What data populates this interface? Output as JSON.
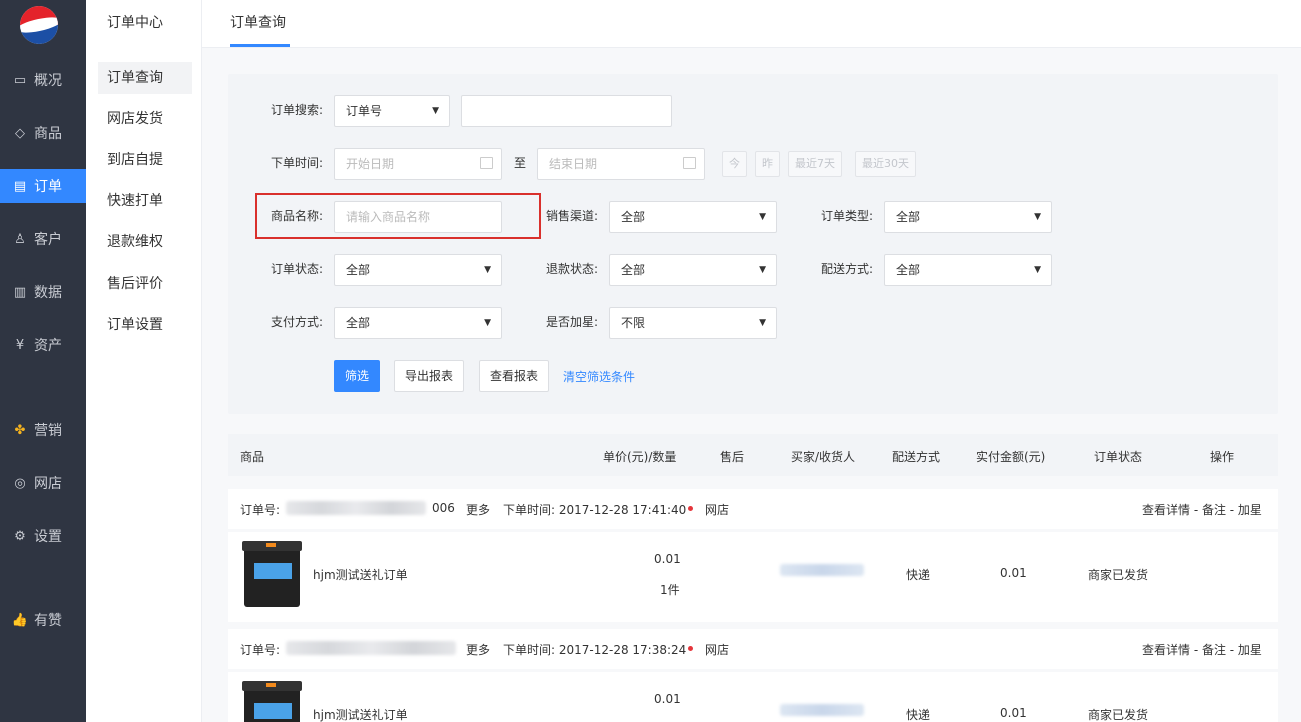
{
  "sidebar": {
    "items": [
      {
        "label": "概况",
        "icon": "monitor-icon"
      },
      {
        "label": "商品",
        "icon": "tag-icon"
      },
      {
        "label": "订单",
        "icon": "document-icon",
        "active": true
      },
      {
        "label": "客户",
        "icon": "user-icon"
      },
      {
        "label": "数据",
        "icon": "bar-chart-icon"
      },
      {
        "label": "资产",
        "icon": "yuan-icon"
      },
      {
        "label": "营销",
        "icon": "apps-icon"
      },
      {
        "label": "网店",
        "icon": "store-icon"
      },
      {
        "label": "设置",
        "icon": "gear-icon"
      },
      {
        "label": "有赞",
        "icon": "thumbs-up-icon"
      }
    ]
  },
  "submenu": {
    "title": "订单中心",
    "items": [
      "订单查询",
      "网店发货",
      "到店自提",
      "快速打单",
      "退款维权",
      "售后评价",
      "订单设置"
    ]
  },
  "tabs": {
    "active": "订单查询"
  },
  "filters": {
    "search_label": "订单搜索:",
    "search_type": "订单号",
    "time_label": "下单时间:",
    "start_placeholder": "开始日期",
    "to": "至",
    "end_placeholder": "结束日期",
    "quick": [
      "今",
      "昨",
      "最近7天",
      "最近30天"
    ],
    "product_label": "商品名称:",
    "product_placeholder": "请输入商品名称",
    "channel_label": "销售渠道:",
    "channel_value": "全部",
    "type_label": "订单类型:",
    "type_value": "全部",
    "status_label": "订单状态:",
    "status_value": "全部",
    "refund_label": "退款状态:",
    "refund_value": "全部",
    "delivery_label": "配送方式:",
    "delivery_value": "全部",
    "pay_label": "支付方式:",
    "pay_value": "全部",
    "star_label": "是否加星:",
    "star_value": "不限",
    "btn_filter": "筛选",
    "btn_export": "导出报表",
    "btn_view": "查看报表",
    "clear": "清空筛选条件"
  },
  "table": {
    "headers": [
      "商品",
      "单价(元)/数量",
      "售后",
      "买家/收货人",
      "配送方式",
      "实付金额(元)",
      "订单状态",
      "操作"
    ]
  },
  "orders": [
    {
      "no_label": "订单号:",
      "no_tail": "006",
      "more": "更多",
      "time": "下单时间: 2017-12-28 17:41:40",
      "source": "网店",
      "actions": "查看详情 - 备注 - 加星",
      "product": "hjm测试送礼订单",
      "price": "0.01",
      "qty": "1件",
      "delivery": "快递",
      "paid": "0.01",
      "status": "商家已发货"
    },
    {
      "no_label": "订单号:",
      "more": "更多",
      "time": "下单时间: 2017-12-28 17:38:24",
      "source": "网店",
      "actions": "查看详情 - 备注 - 加星",
      "product": "hjm测试送礼订单",
      "price": "0.01",
      "delivery": "快递",
      "paid": "0.01",
      "status": "商家已发货"
    }
  ],
  "colors": {
    "accent": "#3388ff",
    "sidebar": "#2f3542",
    "highlight": "#d9302c"
  }
}
